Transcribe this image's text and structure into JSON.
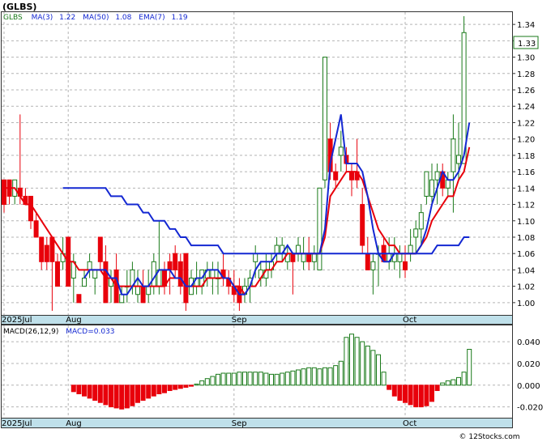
{
  "ticker_label": "(GLBS)",
  "watermark": "© 12Stocks.com",
  "colors": {
    "up": "#1a7a1a",
    "down": "#e8000b",
    "ma3": "#1428d2",
    "ma50": "#1428d2",
    "ema7": "#e8000b",
    "grid": "#b4b4b4",
    "xaxis_band": "#bfe0ea",
    "macd": "#1428d2"
  },
  "legend": {
    "symbol": "GLBS",
    "ma3_label": "MA(3)",
    "ma3_value": "1.22",
    "ma50_label": "MA(50)",
    "ma50_value": "1.08",
    "ema7_label": "EMA(7)",
    "ema7_value": "1.19"
  },
  "macd_legend": {
    "params": "MACD(26,12,9)",
    "label": "MACD=0.033"
  },
  "last_price_tag": "1.33",
  "chart_data": [
    {
      "type": "candlestick",
      "title": "(GLBS)",
      "ylim": [
        0.985,
        1.355
      ],
      "y_ticks": [
        "1.00",
        "1.02",
        "1.04",
        "1.06",
        "1.08",
        "1.10",
        "1.12",
        "1.14",
        "1.16",
        "1.18",
        "1.20",
        "1.22",
        "1.24",
        "1.26",
        "1.28",
        "1.30",
        "1.32",
        "1.34"
      ],
      "x_tick_labels": [
        {
          "label": "2025Jul",
          "index": 0
        },
        {
          "label": "Aug",
          "index": 12
        },
        {
          "label": "Sep",
          "index": 43
        },
        {
          "label": "Oct",
          "index": 75
        }
      ],
      "grid": true,
      "candles": [
        {
          "o": 1.15,
          "h": 1.15,
          "l": 1.11,
          "c": 1.12
        },
        {
          "o": 1.15,
          "h": 1.15,
          "l": 1.12,
          "c": 1.13
        },
        {
          "o": 1.13,
          "h": 1.15,
          "l": 1.12,
          "c": 1.15
        },
        {
          "o": 1.14,
          "h": 1.23,
          "l": 1.12,
          "c": 1.13
        },
        {
          "o": 1.13,
          "h": 1.14,
          "l": 1.12,
          "c": 1.12
        },
        {
          "o": 1.13,
          "h": 1.13,
          "l": 1.09,
          "c": 1.1
        },
        {
          "o": 1.1,
          "h": 1.11,
          "l": 1.08,
          "c": 1.08
        },
        {
          "o": 1.08,
          "h": 1.08,
          "l": 1.04,
          "c": 1.05
        },
        {
          "o": 1.07,
          "h": 1.08,
          "l": 1.04,
          "c": 1.05
        },
        {
          "o": 1.08,
          "h": 1.08,
          "l": 0.99,
          "c": 1.05
        },
        {
          "o": 1.05,
          "h": 1.06,
          "l": 1.02,
          "c": 1.02
        },
        {
          "o": 1.05,
          "h": 1.08,
          "l": 1.04,
          "c": 1.06
        },
        {
          "o": 1.08,
          "h": 1.08,
          "l": 1.02,
          "c": 1.02
        },
        {
          "o": 1.03,
          "h": 1.06,
          "l": 1.0,
          "c": 1.05
        },
        {
          "o": 1.01,
          "h": 1.01,
          "l": 1.0,
          "c": 1.0
        },
        {
          "o": 1.02,
          "h": 1.04,
          "l": 1.02,
          "c": 1.03
        },
        {
          "o": 1.04,
          "h": 1.06,
          "l": 1.03,
          "c": 1.05
        },
        {
          "o": 1.03,
          "h": 1.04,
          "l": 1.01,
          "c": 1.04
        },
        {
          "o": 1.08,
          "h": 1.08,
          "l": 1.04,
          "c": 1.05
        },
        {
          "o": 1.05,
          "h": 1.07,
          "l": 1.0,
          "c": 1.0
        },
        {
          "o": 1.02,
          "h": 1.04,
          "l": 1.0,
          "c": 1.03
        },
        {
          "o": 1.04,
          "h": 1.06,
          "l": 1.0,
          "c": 1.0
        },
        {
          "o": 1.0,
          "h": 1.02,
          "l": 1.0,
          "c": 1.01
        },
        {
          "o": 1.02,
          "h": 1.04,
          "l": 1.0,
          "c": 1.02
        },
        {
          "o": 1.02,
          "h": 1.05,
          "l": 1.01,
          "c": 1.04
        },
        {
          "o": 1.01,
          "h": 1.04,
          "l": 1.0,
          "c": 1.02
        },
        {
          "o": 1.02,
          "h": 1.04,
          "l": 1.0,
          "c": 1.0
        },
        {
          "o": 1.01,
          "h": 1.04,
          "l": 1.0,
          "c": 1.02
        },
        {
          "o": 1.02,
          "h": 1.06,
          "l": 1.01,
          "c": 1.05
        },
        {
          "o": 1.02,
          "h": 1.1,
          "l": 1.01,
          "c": 1.04
        },
        {
          "o": 1.04,
          "h": 1.05,
          "l": 1.01,
          "c": 1.02
        },
        {
          "o": 1.05,
          "h": 1.06,
          "l": 1.01,
          "c": 1.04
        },
        {
          "o": 1.06,
          "h": 1.07,
          "l": 1.03,
          "c": 1.04
        },
        {
          "o": 1.05,
          "h": 1.06,
          "l": 1.01,
          "c": 1.02
        },
        {
          "o": 1.06,
          "h": 1.06,
          "l": 0.99,
          "c": 1.0
        },
        {
          "o": 1.01,
          "h": 1.04,
          "l": 1.01,
          "c": 1.03
        },
        {
          "o": 1.02,
          "h": 1.05,
          "l": 1.01,
          "c": 1.03
        },
        {
          "o": 1.02,
          "h": 1.04,
          "l": 1.01,
          "c": 1.04
        },
        {
          "o": 1.03,
          "h": 1.05,
          "l": 1.02,
          "c": 1.04
        },
        {
          "o": 1.03,
          "h": 1.05,
          "l": 1.01,
          "c": 1.04
        },
        {
          "o": 1.03,
          "h": 1.05,
          "l": 1.01,
          "c": 1.03
        },
        {
          "o": 1.04,
          "h": 1.06,
          "l": 1.02,
          "c": 1.03
        },
        {
          "o": 1.03,
          "h": 1.04,
          "l": 1.01,
          "c": 1.02
        },
        {
          "o": 1.02,
          "h": 1.04,
          "l": 1.0,
          "c": 1.01
        },
        {
          "o": 1.02,
          "h": 1.03,
          "l": 0.99,
          "c": 1.0
        },
        {
          "o": 1.01,
          "h": 1.03,
          "l": 1.0,
          "c": 1.02
        },
        {
          "o": 1.02,
          "h": 1.04,
          "l": 1.0,
          "c": 1.03
        },
        {
          "o": 1.05,
          "h": 1.07,
          "l": 1.03,
          "c": 1.06
        },
        {
          "o": 1.03,
          "h": 1.05,
          "l": 1.02,
          "c": 1.04
        },
        {
          "o": 1.03,
          "h": 1.06,
          "l": 1.02,
          "c": 1.04
        },
        {
          "o": 1.04,
          "h": 1.06,
          "l": 1.03,
          "c": 1.05
        },
        {
          "o": 1.06,
          "h": 1.08,
          "l": 1.05,
          "c": 1.07
        },
        {
          "o": 1.06,
          "h": 1.08,
          "l": 1.05,
          "c": 1.07
        },
        {
          "o": 1.05,
          "h": 1.07,
          "l": 1.04,
          "c": 1.06
        },
        {
          "o": 1.06,
          "h": 1.06,
          "l": 1.01,
          "c": 1.05
        },
        {
          "o": 1.06,
          "h": 1.08,
          "l": 1.05,
          "c": 1.07
        },
        {
          "o": 1.05,
          "h": 1.08,
          "l": 1.04,
          "c": 1.06
        },
        {
          "o": 1.06,
          "h": 1.08,
          "l": 1.04,
          "c": 1.05
        },
        {
          "o": 1.05,
          "h": 1.07,
          "l": 1.04,
          "c": 1.06
        },
        {
          "o": 1.04,
          "h": 1.14,
          "l": 1.04,
          "c": 1.14
        },
        {
          "o": 1.15,
          "h": 1.3,
          "l": 1.14,
          "c": 1.3
        },
        {
          "o": 1.2,
          "h": 1.22,
          "l": 1.15,
          "c": 1.16
        },
        {
          "o": 1.16,
          "h": 1.17,
          "l": 1.14,
          "c": 1.15
        },
        {
          "o": 1.18,
          "h": 1.21,
          "l": 1.16,
          "c": 1.19
        },
        {
          "o": 1.18,
          "h": 1.19,
          "l": 1.16,
          "c": 1.17
        },
        {
          "o": 1.16,
          "h": 1.17,
          "l": 1.13,
          "c": 1.15
        },
        {
          "o": 1.16,
          "h": 1.2,
          "l": 1.14,
          "c": 1.15
        },
        {
          "o": 1.12,
          "h": 1.14,
          "l": 1.06,
          "c": 1.07
        },
        {
          "o": 1.06,
          "h": 1.08,
          "l": 1.04,
          "c": 1.04
        },
        {
          "o": 1.04,
          "h": 1.06,
          "l": 1.01,
          "c": 1.05
        },
        {
          "o": 1.06,
          "h": 1.07,
          "l": 1.02,
          "c": 1.06
        },
        {
          "o": 1.07,
          "h": 1.08,
          "l": 1.05,
          "c": 1.05
        },
        {
          "o": 1.05,
          "h": 1.08,
          "l": 1.04,
          "c": 1.06
        },
        {
          "o": 1.05,
          "h": 1.08,
          "l": 1.04,
          "c": 1.06
        },
        {
          "o": 1.05,
          "h": 1.07,
          "l": 1.03,
          "c": 1.06
        },
        {
          "o": 1.05,
          "h": 1.07,
          "l": 1.03,
          "c": 1.04
        },
        {
          "o": 1.06,
          "h": 1.09,
          "l": 1.05,
          "c": 1.07
        },
        {
          "o": 1.08,
          "h": 1.1,
          "l": 1.06,
          "c": 1.09
        },
        {
          "o": 1.09,
          "h": 1.12,
          "l": 1.07,
          "c": 1.11
        },
        {
          "o": 1.13,
          "h": 1.16,
          "l": 1.12,
          "c": 1.16
        },
        {
          "o": 1.13,
          "h": 1.17,
          "l": 1.12,
          "c": 1.15
        },
        {
          "o": 1.15,
          "h": 1.17,
          "l": 1.12,
          "c": 1.16
        },
        {
          "o": 1.16,
          "h": 1.17,
          "l": 1.13,
          "c": 1.14
        },
        {
          "o": 1.14,
          "h": 1.16,
          "l": 1.13,
          "c": 1.15
        },
        {
          "o": 1.16,
          "h": 1.23,
          "l": 1.11,
          "c": 1.2
        },
        {
          "o": 1.17,
          "h": 1.22,
          "l": 1.15,
          "c": 1.18
        },
        {
          "o": 1.17,
          "h": 1.35,
          "l": 1.17,
          "c": 1.33
        }
      ],
      "ma3": [
        null,
        null,
        null,
        null,
        null,
        null,
        null,
        null,
        null,
        null,
        null,
        null,
        null,
        null,
        null,
        1.03,
        1.04,
        1.04,
        1.04,
        1.04,
        1.03,
        1.03,
        1.01,
        1.01,
        1.02,
        1.03,
        1.02,
        1.02,
        1.03,
        1.04,
        1.04,
        1.04,
        1.03,
        1.03,
        1.02,
        1.02,
        1.03,
        1.03,
        1.04,
        1.04,
        1.04,
        1.03,
        1.03,
        1.02,
        1.01,
        1.01,
        1.02,
        1.04,
        1.05,
        1.05,
        1.05,
        1.06,
        1.06,
        1.07,
        1.06,
        1.06,
        1.06,
        1.06,
        1.06,
        1.06,
        1.09,
        1.17,
        1.2,
        1.23,
        1.17,
        1.17,
        1.17,
        1.16,
        1.13,
        1.09,
        1.06,
        1.05,
        1.05,
        1.06,
        1.06,
        1.06,
        1.06,
        1.06,
        1.07,
        1.09,
        1.12,
        1.14,
        1.16,
        1.15,
        1.15,
        1.16,
        1.18,
        1.22
      ],
      "ma50": [
        null,
        null,
        null,
        null,
        null,
        null,
        null,
        null,
        null,
        null,
        null,
        1.14,
        1.14,
        1.14,
        1.14,
        1.14,
        1.14,
        1.14,
        1.14,
        1.14,
        1.13,
        1.13,
        1.13,
        1.12,
        1.12,
        1.12,
        1.11,
        1.11,
        1.1,
        1.1,
        1.1,
        1.09,
        1.09,
        1.08,
        1.08,
        1.07,
        1.07,
        1.07,
        1.07,
        1.07,
        1.07,
        1.06,
        1.06,
        1.06,
        1.06,
        1.06,
        1.06,
        1.06,
        1.06,
        1.06,
        1.06,
        1.06,
        1.06,
        1.06,
        1.06,
        1.06,
        1.06,
        1.06,
        1.06,
        1.06,
        1.06,
        1.06,
        1.06,
        1.06,
        1.06,
        1.06,
        1.06,
        1.06,
        1.06,
        1.06,
        1.06,
        1.06,
        1.06,
        1.06,
        1.06,
        1.06,
        1.06,
        1.06,
        1.06,
        1.06,
        1.06,
        1.07,
        1.07,
        1.07,
        1.07,
        1.07,
        1.08,
        1.08
      ],
      "ema7": [
        1.14,
        1.14,
        1.14,
        1.13,
        1.12,
        1.12,
        1.11,
        1.1,
        1.09,
        1.08,
        1.07,
        1.06,
        1.05,
        1.05,
        1.04,
        1.04,
        1.04,
        1.04,
        1.04,
        1.03,
        1.03,
        1.02,
        1.02,
        1.02,
        1.02,
        1.02,
        1.02,
        1.02,
        1.02,
        1.02,
        1.02,
        1.03,
        1.03,
        1.03,
        1.02,
        1.02,
        1.02,
        1.02,
        1.03,
        1.03,
        1.03,
        1.03,
        1.03,
        1.02,
        1.02,
        1.01,
        1.02,
        1.02,
        1.03,
        1.04,
        1.04,
        1.05,
        1.05,
        1.06,
        1.06,
        1.06,
        1.06,
        1.06,
        1.06,
        1.06,
        1.08,
        1.13,
        1.14,
        1.15,
        1.16,
        1.16,
        1.16,
        1.15,
        1.13,
        1.11,
        1.09,
        1.08,
        1.07,
        1.07,
        1.06,
        1.06,
        1.06,
        1.06,
        1.07,
        1.08,
        1.1,
        1.11,
        1.12,
        1.13,
        1.13,
        1.15,
        1.16,
        1.19
      ],
      "last_value": 1.33
    },
    {
      "type": "bar",
      "title": "MACD(26,12,9)",
      "ylim": [
        -0.03,
        0.055
      ],
      "y_ticks": [
        "0.040",
        "0.020",
        "0.000",
        "-0.020"
      ],
      "x_tick_labels": [
        {
          "label": "2025Jul",
          "index": 0
        },
        {
          "label": "Aug",
          "index": 12
        },
        {
          "label": "Sep",
          "index": 43
        },
        {
          "label": "Oct",
          "index": 75
        }
      ],
      "values": [
        -0.006,
        -0.008,
        -0.01,
        -0.012,
        -0.014,
        -0.016,
        -0.018,
        -0.02,
        -0.021,
        -0.022,
        -0.021,
        -0.019,
        -0.016,
        -0.014,
        -0.012,
        -0.01,
        -0.008,
        -0.007,
        -0.005,
        -0.004,
        -0.003,
        -0.002,
        -0.001,
        0.001,
        0.004,
        0.006,
        0.008,
        0.01,
        0.011,
        0.011,
        0.011,
        0.012,
        0.012,
        0.012,
        0.012,
        0.012,
        0.011,
        0.01,
        0.01,
        0.011,
        0.012,
        0.013,
        0.014,
        0.015,
        0.016,
        0.016,
        0.015,
        0.016,
        0.016,
        0.018,
        0.022,
        0.044,
        0.047,
        0.044,
        0.04,
        0.036,
        0.032,
        0.028,
        0.012,
        -0.004,
        -0.01,
        -0.014,
        -0.016,
        -0.018,
        -0.02,
        -0.02,
        -0.019,
        -0.015,
        -0.005,
        0.002,
        0.004,
        0.005,
        0.007,
        0.012,
        0.033
      ],
      "last_value": 0.033
    }
  ]
}
